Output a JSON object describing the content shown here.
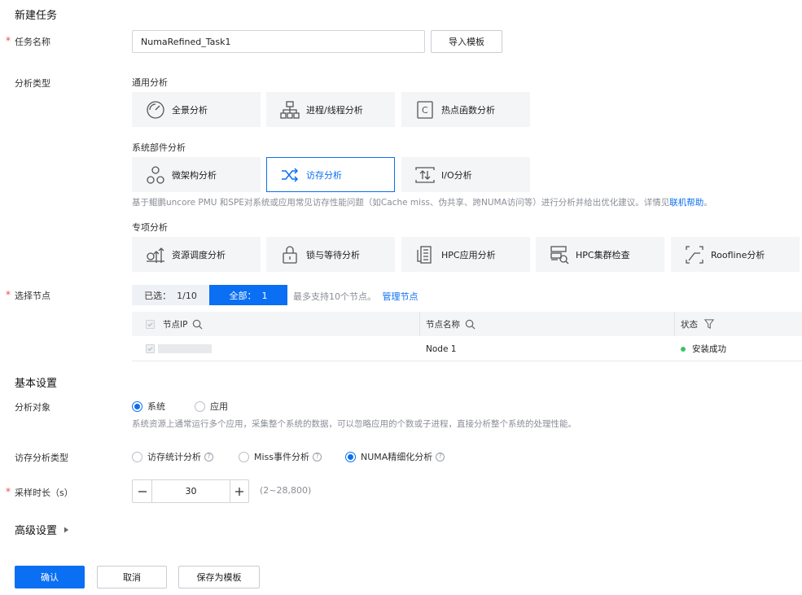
{
  "page": {
    "title": "新建任务"
  },
  "task_name": {
    "label": "任务名称",
    "value": "NumaRefined_Task1",
    "import_button": "导入模板"
  },
  "analysis_type": {
    "label": "分析类型",
    "general": {
      "label": "通用分析",
      "cards": [
        {
          "label": "全景分析",
          "icon": "gauge-icon"
        },
        {
          "label": "进程/线程分析",
          "icon": "process-tree-icon"
        },
        {
          "label": "热点函数分析",
          "icon": "function-c-icon"
        }
      ]
    },
    "system": {
      "label": "系统部件分析",
      "cards": [
        {
          "label": "微架构分析",
          "icon": "micro-arch-icon"
        },
        {
          "label": "访存分析",
          "icon": "shuffle-icon",
          "selected": true
        },
        {
          "label": "I/O分析",
          "icon": "io-icon"
        }
      ],
      "description_prefix": "基于鲲鹏uncore PMU 和SPE对系统或应用常见访存性能问题（如Cache miss、伪共享、跨NUMA访问等）进行分析并给出优化建议。详情见",
      "description_link": "联机帮助",
      "description_suffix": "。"
    },
    "special": {
      "label": "专项分析",
      "cards": [
        {
          "label": "资源调度分析",
          "icon": "schedule-icon"
        },
        {
          "label": "锁与等待分析",
          "icon": "lock-icon"
        },
        {
          "label": "HPC应用分析",
          "icon": "hpc-app-icon"
        },
        {
          "label": "HPC集群检查",
          "icon": "hpc-cluster-icon"
        },
        {
          "label": "Roofline分析",
          "icon": "roofline-icon"
        }
      ]
    }
  },
  "nodes": {
    "label": "选择节点",
    "selected_tab": "已选：  1/10",
    "all_tab": "全部：  1",
    "hint": "最多支持10个节点。",
    "manage_link": "管理节点",
    "columns": [
      "节点IP",
      "节点名称",
      "状态"
    ],
    "rows": [
      {
        "ip": "",
        "name": "Node 1",
        "status": "安装成功",
        "status_color": "#3fc06d"
      }
    ]
  },
  "basic": {
    "title": "基本设置",
    "target": {
      "label": "分析对象",
      "options": [
        "系统",
        "应用"
      ],
      "selected": "系统",
      "note": "系统资源上通常运行多个应用，采集整个系统的数据，可以忽略应用的个数或子进程，直接分析整个系统的处理性能。"
    },
    "mem_type": {
      "label": "访存分析类型",
      "options": [
        "访存统计分析",
        "Miss事件分析",
        "NUMA精细化分析"
      ],
      "selected": "NUMA精细化分析"
    },
    "duration": {
      "label": "采样时长（s）",
      "value": "30",
      "range": "(2~28,800)"
    }
  },
  "advanced": {
    "title": "高级设置"
  },
  "footer": {
    "confirm": "确认",
    "cancel": "取消",
    "save_template": "保存为模板"
  },
  "colors": {
    "accent": "#0a6ff2",
    "required": "#e34d59"
  }
}
